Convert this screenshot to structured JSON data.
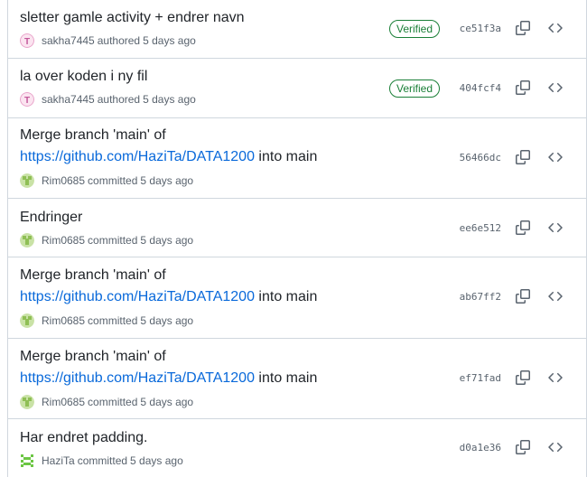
{
  "colors": {
    "link": "#0969da",
    "verified": "#1a7f37",
    "muted": "#59636e",
    "border": "#d0d7de",
    "avatar_sakha": "#e8a0c8",
    "avatar_rim": "#9cc46b",
    "avatar_hazita": "#6cc644"
  },
  "icons": {
    "copy": "copy-icon",
    "code": "code-icon"
  },
  "commits": [
    {
      "title": "sletter gamle activity + endrer navn",
      "author": "sakha7445",
      "action": "authored",
      "time": "5 days ago",
      "verified": "Verified",
      "sha": "ce51f3a"
    },
    {
      "title": "la over koden i ny fil",
      "author": "sakha7445",
      "action": "authored",
      "time": "5 days ago",
      "verified": "Verified",
      "sha": "404fcf4"
    },
    {
      "title_prefix": "Merge branch 'main' of",
      "title_link": "https://github.com/HaziTa/DATA1200",
      "title_suffix": " into main",
      "author": "Rim0685",
      "action": "committed",
      "time": "5 days ago",
      "sha": "56466dc"
    },
    {
      "title": "Endringer",
      "author": "Rim0685",
      "action": "committed",
      "time": "5 days ago",
      "sha": "ee6e512"
    },
    {
      "title_prefix": "Merge branch 'main' of",
      "title_link": "https://github.com/HaziTa/DATA1200",
      "title_suffix": " into main",
      "author": "Rim0685",
      "action": "committed",
      "time": "5 days ago",
      "sha": "ab67ff2"
    },
    {
      "title_prefix": "Merge branch 'main' of",
      "title_link": "https://github.com/HaziTa/DATA1200",
      "title_suffix": " into main",
      "author": "Rim0685",
      "action": "committed",
      "time": "5 days ago",
      "sha": "ef71fad"
    },
    {
      "title": "Har endret padding.",
      "author": "HaziTa",
      "action": "committed",
      "time": "5 days ago",
      "sha": "d0a1e36"
    }
  ]
}
